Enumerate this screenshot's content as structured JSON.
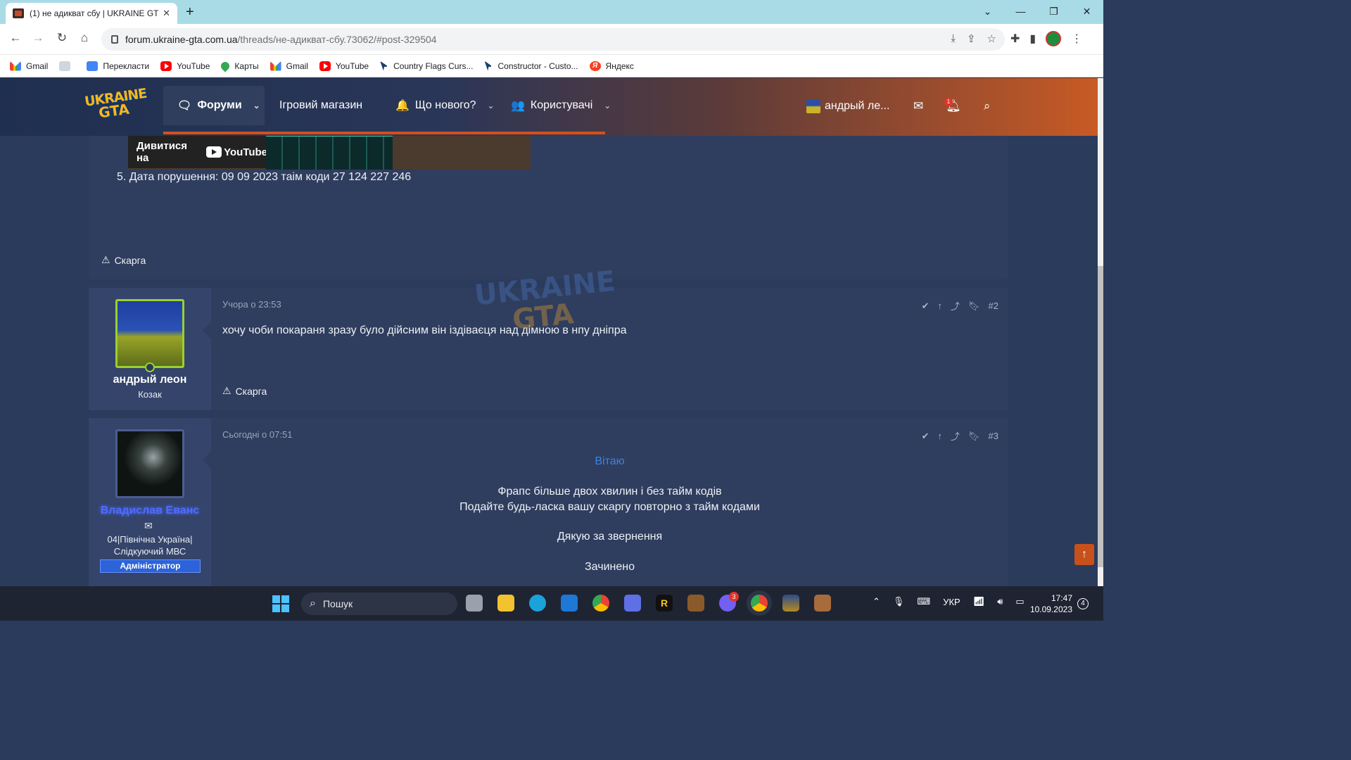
{
  "browser": {
    "tab_title": "(1) не адикват сбу | UKRAINE GT",
    "tab_close": "✕",
    "new_tab": "+",
    "url_host": "forum.ukraine-gta.com.ua",
    "url_path": "/threads/не-адикват-сбу.73062/#post-329504",
    "bookmarks": [
      "Gmail",
      "",
      "Перекласти",
      "YouTube",
      "Карты",
      "Gmail",
      "YouTube",
      "Country Flags Curs...",
      "Constructor - Custo...",
      "Яндекс"
    ]
  },
  "site": {
    "logo_top": "UKRAINE",
    "logo_bottom": "GTA",
    "nav": {
      "forums": "Форуми",
      "shop": "Ігровий магазин",
      "whats_new": "Що нового?",
      "users": "Користувачі"
    },
    "user_short": "андрый ле...",
    "alert_count": "1"
  },
  "post1": {
    "watch_on": "Дивитися на",
    "youtube": "YouTube",
    "text": "5. Дата порушення: 09 09 2023 таім коди 27 124 227 246",
    "report": "Скарга"
  },
  "post2": {
    "author": "андрый леон",
    "user_title": "Козак",
    "date": "Учора о 23:53",
    "number": "#2",
    "text": "хочу чоби покараня зразу було дійсним він іздіваєця над дімною в нпу дніпра",
    "report": "Скарга"
  },
  "post3": {
    "author": "Владислав Еванс",
    "user_title_1": "04|Північна Україна|",
    "user_title_2": "Слідкуючий МВС",
    "badge": "Адміністратор",
    "date": "Сьогодні о 07:51",
    "number": "#3",
    "greeting": "Вітаю",
    "line1": "Фрапс більше двох хвилин і без тайм кодів",
    "line2": "Подайте будь-ласка вашу скаргу повторно з тайм кодами",
    "thanks": "Дякую за звернення",
    "closed": "Зачинено"
  },
  "taskbar": {
    "search": "Пошук",
    "viber_badge": "3",
    "lang": "УКР",
    "time": "17:47",
    "date": "10.09.2023",
    "notifications": "4"
  },
  "colors": {
    "accent": "#d4501a",
    "page_bg": "#2b3b5c",
    "post_bg": "#2f3d5e",
    "admin_name": "#4f6bff",
    "greeting": "#3b83e6"
  }
}
